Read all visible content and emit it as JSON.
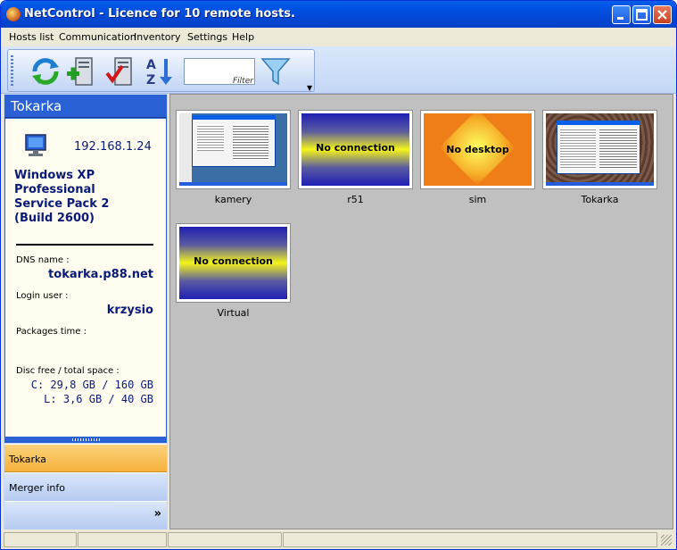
{
  "window": {
    "title": "NetControl - Licence for 10 remote hosts.",
    "min_icon": "minimize-icon",
    "max_icon": "maximize-icon",
    "close_icon": "close-icon"
  },
  "menu": [
    {
      "label": "Hosts list"
    },
    {
      "label": "Communication"
    },
    {
      "label": "Inventory"
    },
    {
      "label": "Settings"
    },
    {
      "label": "Help"
    }
  ],
  "toolbar": {
    "refresh_icon": "refresh-icon",
    "add_host_icon": "add-host-icon",
    "check_host_icon": "check-host-icon",
    "sort_icon": "sort-az-icon",
    "filter_value": "",
    "filter_label": "Filter",
    "filter_icon": "funnel-icon"
  },
  "host_panel": {
    "title": "Tokarka",
    "ip": "192.168.1.24",
    "os_lines": [
      "Windows XP",
      "Professional",
      "Service Pack 2",
      "(Build 2600)"
    ],
    "dns_label": "DNS name :",
    "dns_value": "tokarka.p88.net",
    "login_label": "Login user :",
    "login_value": "krzysio",
    "packages_label": "Packages time :",
    "disc_label": "Disc free / total space :",
    "disc_c": "C: 29,8 GB / 160 GB",
    "disc_l": "L: 3,6 GB / 40 GB"
  },
  "nav": {
    "active": "Tokarka",
    "merger": "Merger info",
    "more_icon": "chevron-double-down-icon"
  },
  "hosts": [
    {
      "name": "kamery",
      "state": "screenshot"
    },
    {
      "name": "r51",
      "state": "No connection"
    },
    {
      "name": "sim",
      "state": "No desktop"
    },
    {
      "name": "Tokarka",
      "state": "screenshot"
    },
    {
      "name": "Virtual",
      "state": "No connection"
    }
  ]
}
